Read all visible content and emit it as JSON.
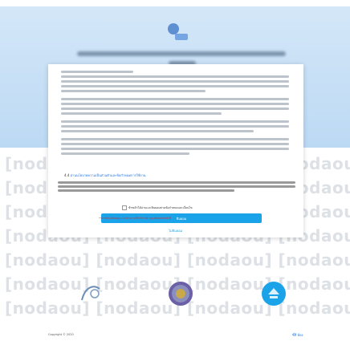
{
  "watermark": {
    "text": "[nodaou] [nodaou] [nodaou] [nodaou] [nodaou] [nodaou]"
  },
  "consent": {
    "link_text": "อ่านนโยบายความเป็นส่วนตัวและข้อกำหนดการใช้งาน",
    "checkbox_label": "ข้าพเจ้าได้อ่านและยินยอมตามข้อกำหนดและเงื่อนไข",
    "accept_label": "ยินยอม",
    "decline_label": "ไม่ยินยอม",
    "note": "**หากท่านไม่ยินยอม จะไม่สามารถใช้บริการได้ กรุณาติดต่อเจ้าหน้าที่"
  },
  "footer": {
    "copyright": "Copyright © 2020",
    "link": "ซิ์สี่ ห้อง"
  },
  "colors": {
    "accent": "#1aa3e8",
    "band": "#c9e1f7"
  }
}
